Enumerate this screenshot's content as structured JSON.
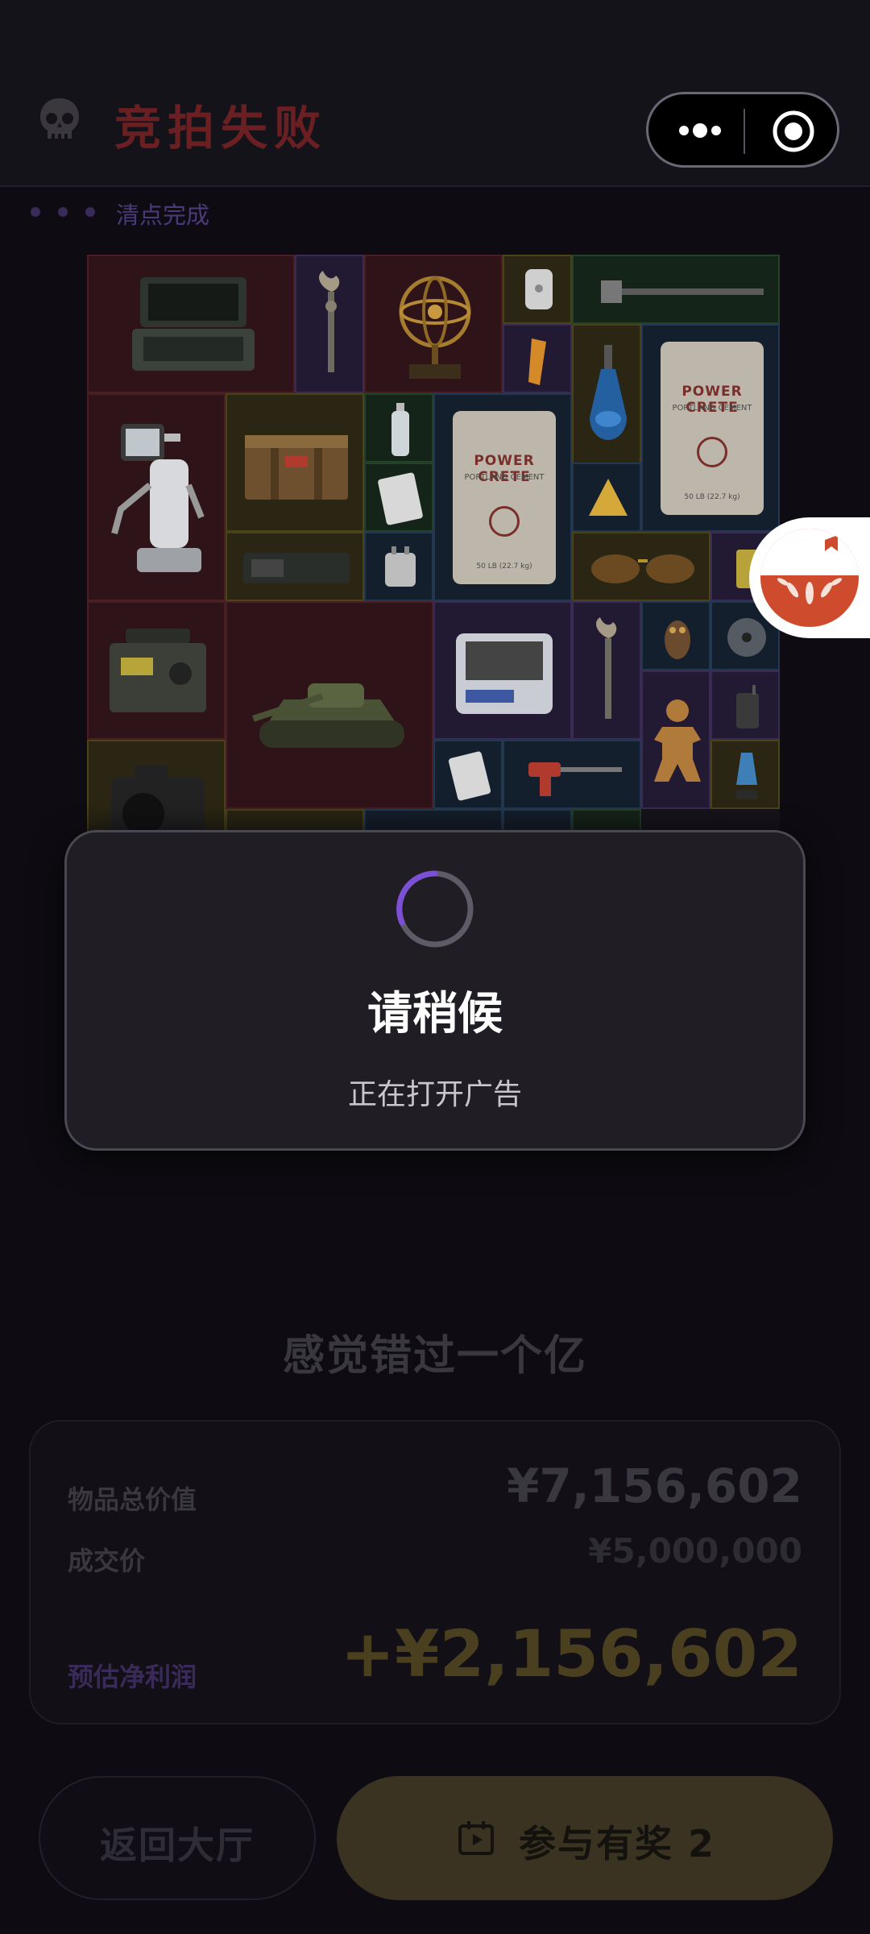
{
  "header": {
    "title": "竞拍失败",
    "status": "清点完成"
  },
  "modal": {
    "title": "请稍候",
    "subtitle": "正在打开广告"
  },
  "grid": {
    "bag_title": "POWER CRETE",
    "bag_sub": "PORTLAND CEMENT",
    "bag_bottom": "50 LB (22.7 kg)"
  },
  "summary": {
    "tagline": "感觉错过一个亿",
    "total_label": "物品总价值",
    "total_value": "¥7,156,602",
    "deal_label": "成交价",
    "deal_value": "¥5,000,000",
    "profit_label": "预估净利润",
    "profit_value": "+¥2,156,602"
  },
  "buttons": {
    "back": "返回大厅",
    "play": "参与有奖 2"
  },
  "colors": {
    "accent_purple": "#7b4fd6",
    "gold": "#f0c43a",
    "fail_red": "#c0383c"
  }
}
